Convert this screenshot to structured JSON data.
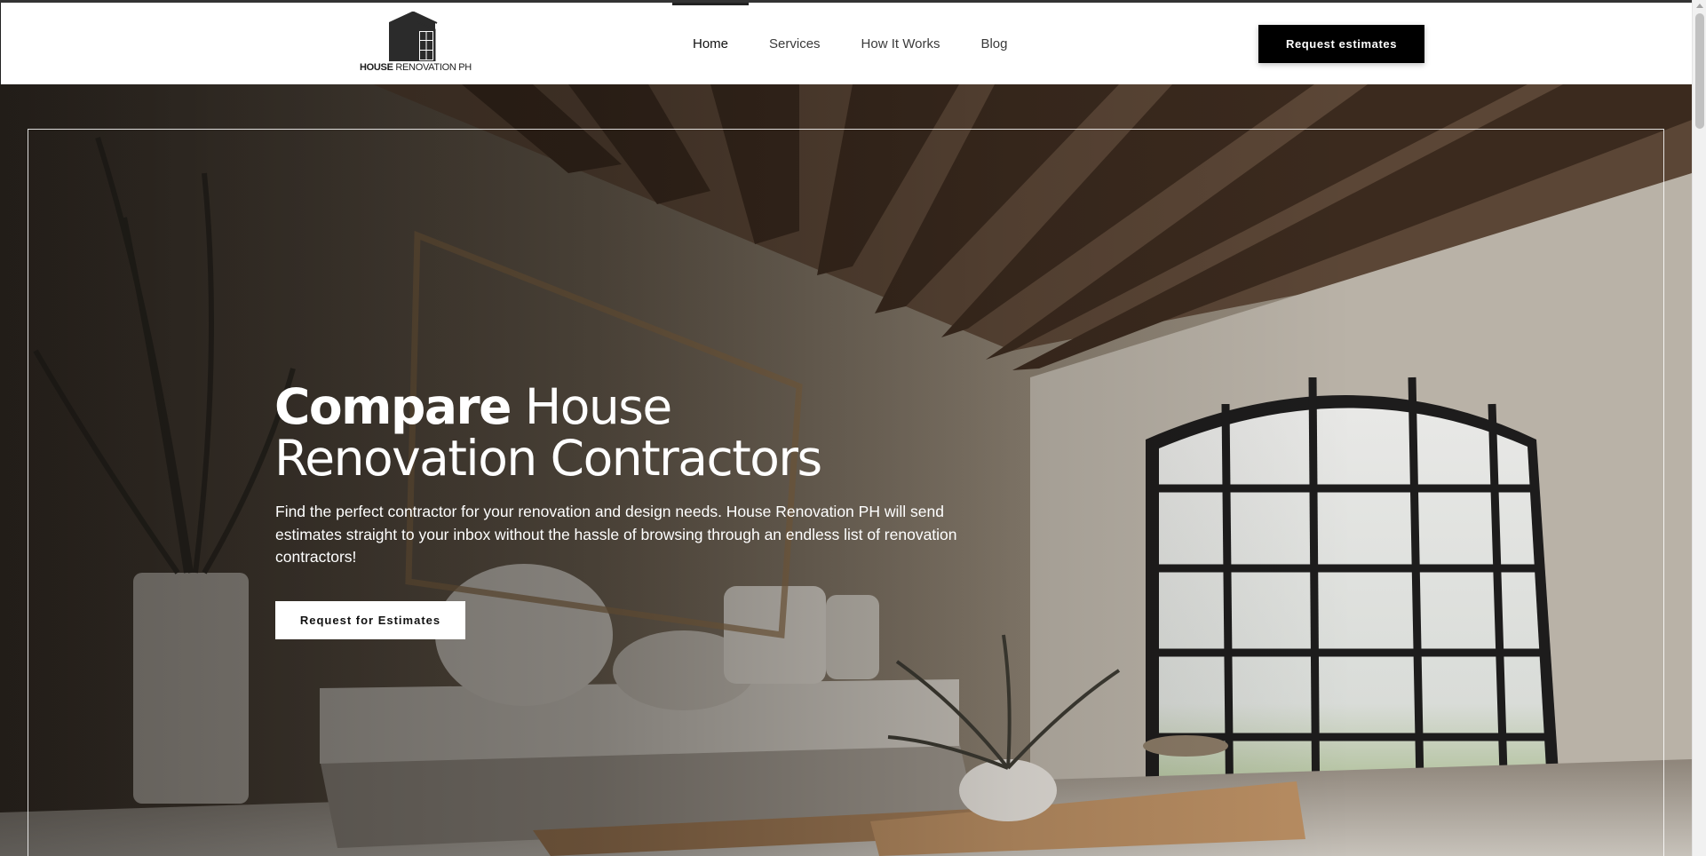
{
  "header": {
    "logo": {
      "brand_bold": "HOUSE",
      "brand_rest": " RENOVATION PH"
    },
    "nav": [
      {
        "label": "Home",
        "active": true
      },
      {
        "label": "Services",
        "active": false
      },
      {
        "label": "How It Works",
        "active": false
      },
      {
        "label": "Blog",
        "active": false
      }
    ],
    "cta_label": "Request estimates"
  },
  "hero": {
    "title_bold": "Compare",
    "title_light_1": " House",
    "title_light_2": "Renovation Contractors",
    "subtitle": "Find the perfect contractor for your renovation and design needs. House Renovation PH will send estimates straight to your inbox without the hassle of browsing through an endless list of renovation contractors!",
    "cta_label": "Request for Estimates",
    "background": "photo-living-room-wooden-beams-arched-window"
  },
  "colors": {
    "accent": "#000000",
    "header_bg": "#ffffff",
    "hero_text": "#ffffff"
  },
  "icons": [
    "house-logo-icon"
  ]
}
